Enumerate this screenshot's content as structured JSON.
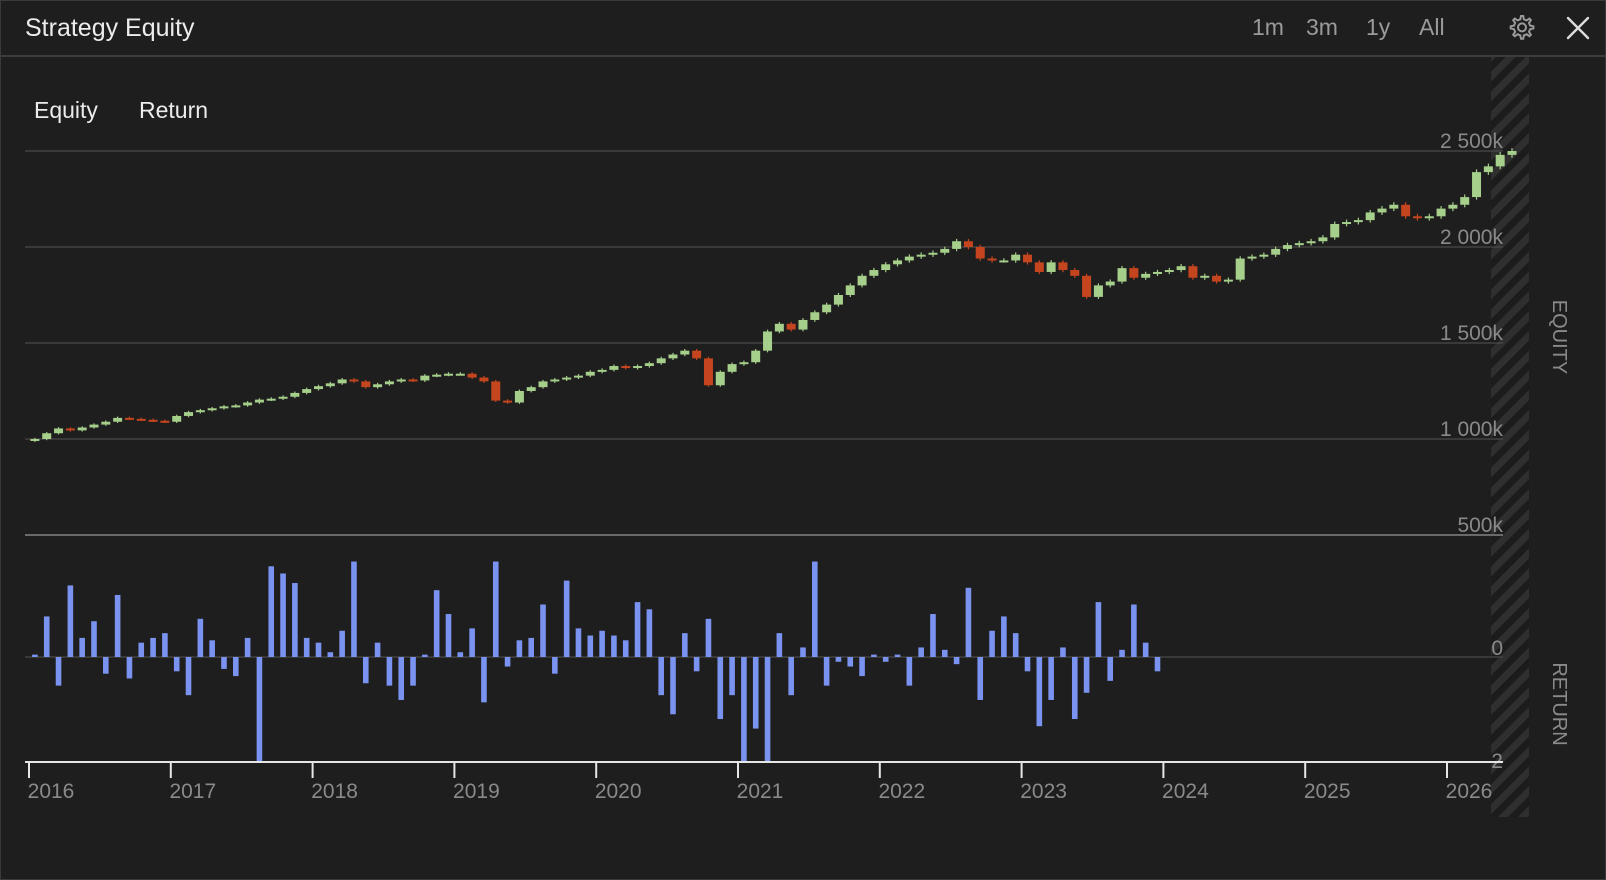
{
  "window": {
    "title": "Strategy Equity",
    "range_buttons": [
      "1m",
      "3m",
      "1y",
      "All"
    ]
  },
  "legend": [
    "Equity",
    "Return"
  ],
  "colors": {
    "up": "#a5cf8a",
    "down": "#c5451f",
    "returns": "#7b93f0",
    "grid": "#4a4a4a",
    "axis_text": "#8a8a8a"
  },
  "chart_data": [
    {
      "type": "candlestick",
      "ylabel": "EQUITY",
      "yticks": [
        "500k",
        "1 000k",
        "1 500k",
        "2 000k",
        "2 500k"
      ],
      "ylim": [
        500000,
        2500000
      ],
      "grid": true,
      "x_start": "2016-01",
      "values": [
        1000000,
        1030000,
        1055000,
        1045000,
        1060000,
        1075000,
        1090000,
        1110000,
        1105000,
        1100000,
        1095000,
        1090000,
        1120000,
        1140000,
        1150000,
        1160000,
        1170000,
        1175000,
        1190000,
        1205000,
        1210000,
        1220000,
        1240000,
        1260000,
        1275000,
        1290000,
        1310000,
        1300000,
        1270000,
        1285000,
        1300000,
        1310000,
        1305000,
        1330000,
        1335000,
        1340000,
        1340000,
        1320000,
        1300000,
        1200000,
        1190000,
        1250000,
        1270000,
        1300000,
        1310000,
        1320000,
        1330000,
        1350000,
        1360000,
        1380000,
        1370000,
        1380000,
        1395000,
        1420000,
        1440000,
        1460000,
        1420000,
        1280000,
        1350000,
        1390000,
        1400000,
        1460000,
        1560000,
        1600000,
        1570000,
        1620000,
        1660000,
        1700000,
        1750000,
        1800000,
        1850000,
        1880000,
        1910000,
        1930000,
        1950000,
        1960000,
        1970000,
        1990000,
        2030000,
        2000000,
        1940000,
        1930000,
        1930000,
        1960000,
        1920000,
        1870000,
        1920000,
        1880000,
        1850000,
        1740000,
        1800000,
        1820000,
        1890000,
        1840000,
        1860000,
        1870000,
        1880000,
        1900000,
        1840000,
        1850000,
        1820000,
        1830000,
        1940000,
        1950000,
        1960000,
        1990000,
        2010000,
        2020000,
        2030000,
        2050000,
        2120000,
        2130000,
        2140000,
        2180000,
        2200000,
        2220000,
        2160000,
        2150000,
        2160000,
        2200000,
        2220000,
        2260000,
        2390000,
        2420000,
        2480000,
        2500000
      ]
    },
    {
      "type": "bar",
      "ylabel": "RETURN",
      "yticks": [
        "-2",
        "0"
      ],
      "ylim": [
        -2.2,
        2.0
      ],
      "x_start": "2016-01",
      "xticks": [
        "2016",
        "2017",
        "2018",
        "2019",
        "2020",
        "2021",
        "2022",
        "2023",
        "2024",
        "2025",
        "2026"
      ],
      "values": [
        0.05,
        0.85,
        -0.6,
        1.5,
        0.4,
        0.75,
        -0.35,
        1.3,
        -0.45,
        0.3,
        0.4,
        0.5,
        -0.3,
        -0.8,
        0.8,
        0.35,
        -0.25,
        -0.4,
        0.4,
        -3.9,
        1.9,
        1.75,
        1.55,
        0.4,
        0.3,
        0.1,
        0.55,
        2.3,
        -0.55,
        0.3,
        -0.6,
        -0.9,
        -0.6,
        0.05,
        1.4,
        0.9,
        0.1,
        0.6,
        -0.95,
        2.6,
        -0.2,
        0.35,
        0.4,
        1.1,
        -0.35,
        1.6,
        0.6,
        0.45,
        0.55,
        0.45,
        0.35,
        1.15,
        1.0,
        -0.8,
        -1.2,
        0.5,
        -0.3,
        0.8,
        -1.3,
        -0.8,
        -3.5,
        -1.5,
        -3.6,
        0.5,
        -0.8,
        0.2,
        3.2,
        -0.6,
        -0.1,
        -0.2,
        -0.4,
        0.05,
        -0.1,
        0.05,
        -0.6,
        0.2,
        0.9,
        0.15,
        -0.15,
        1.45,
        -0.9,
        0.55,
        0.85,
        0.5,
        -0.3,
        -1.45,
        -0.9,
        0.2,
        -1.3,
        -0.75,
        1.15,
        -0.5,
        0.15,
        1.1,
        0.3,
        -0.3
      ]
    }
  ]
}
